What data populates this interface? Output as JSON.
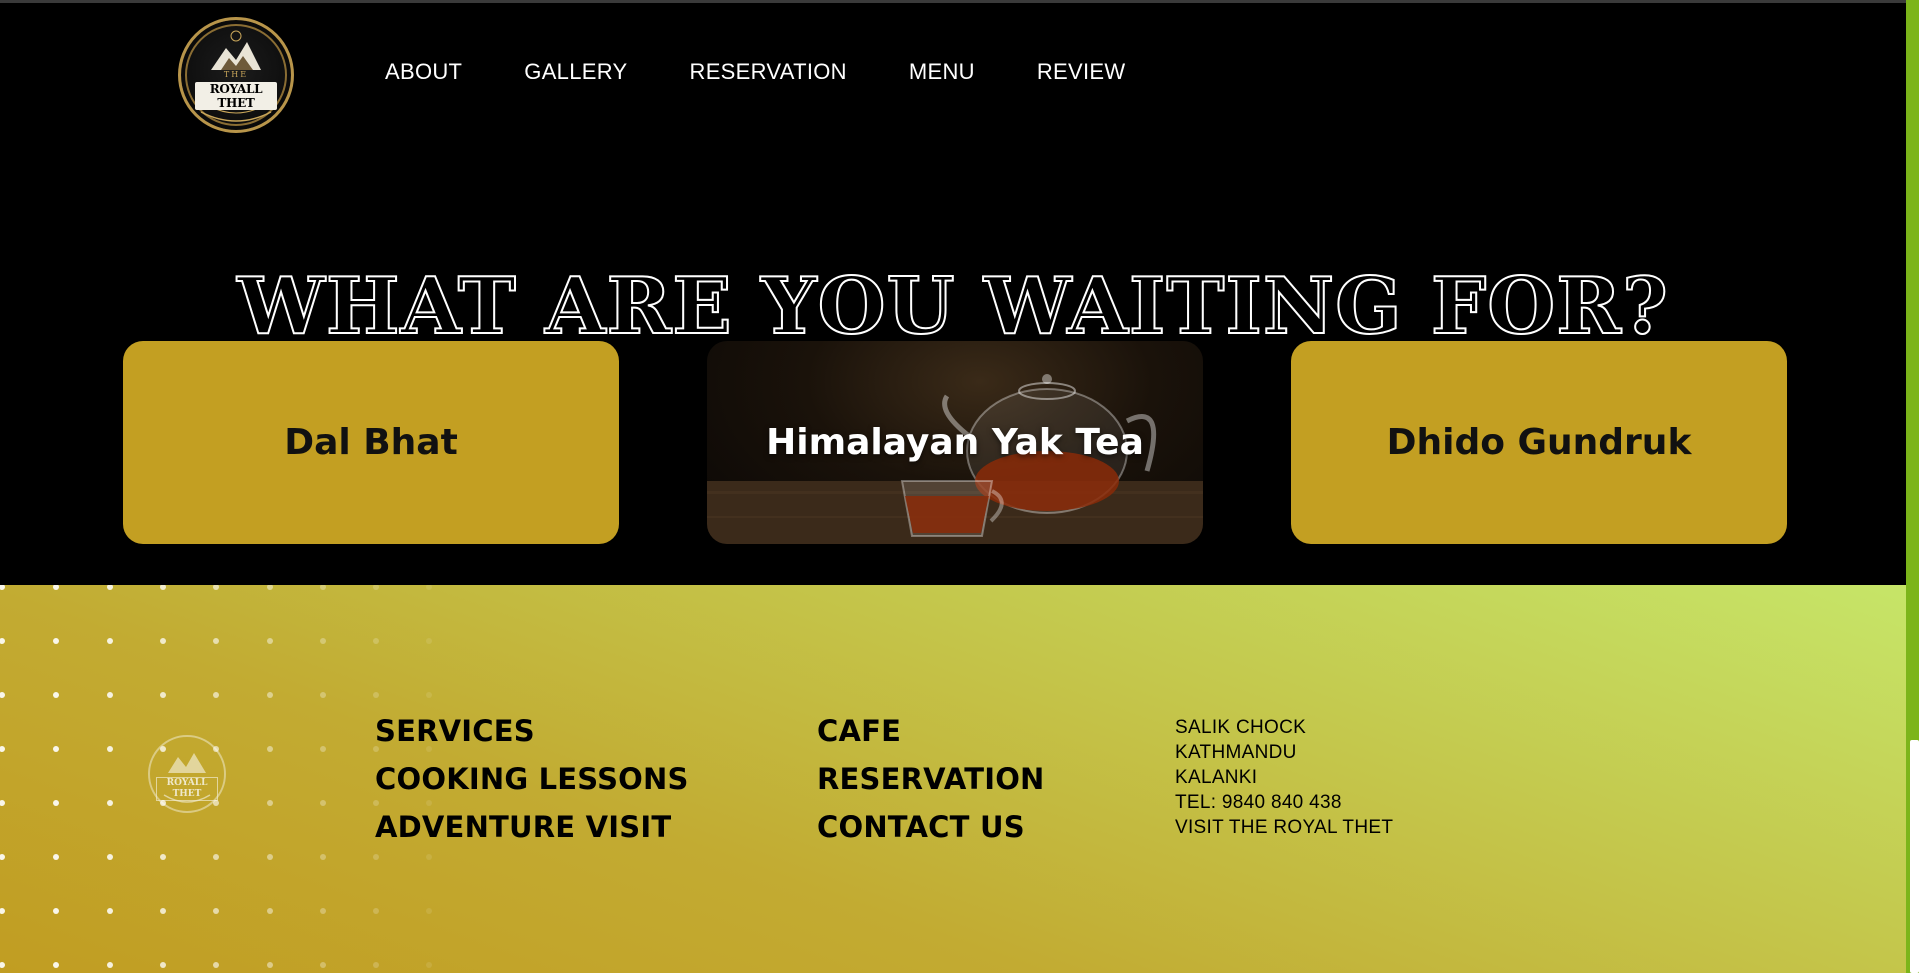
{
  "brand": {
    "logo_top": "THE",
    "logo_name": "ROYALL THET"
  },
  "nav": {
    "items": [
      {
        "label": "ABOUT"
      },
      {
        "label": "GALLERY"
      },
      {
        "label": "RESERVATION"
      },
      {
        "label": "MENU"
      },
      {
        "label": "REVIEW"
      }
    ]
  },
  "hero": {
    "headline": "WHAT ARE YOU WAITING FOR?"
  },
  "cards": [
    {
      "label": "Dal Bhat"
    },
    {
      "label": "Himalayan Yak Tea"
    },
    {
      "label": "Dhido Gundruk"
    }
  ],
  "footer": {
    "logo_name": "ROYALL THET",
    "col1": [
      "SERVICES",
      "COOKING LESSONS",
      "ADVENTURE VISIT"
    ],
    "col2": [
      "CAFE",
      "RESERVATION",
      "CONTACT US"
    ],
    "address": [
      "SALIK CHOCK",
      "KATHMANDU",
      "KALANKI",
      "TEL: 9840 840 438",
      "VISIT THE ROYAL THET"
    ]
  },
  "colors": {
    "card_gold": "#c39f22",
    "footer_start": "#c6e568",
    "footer_end": "#c19d22",
    "scrollbar": "#7cb51a"
  },
  "icons": [
    "logo-emblem",
    "teapot-image"
  ]
}
